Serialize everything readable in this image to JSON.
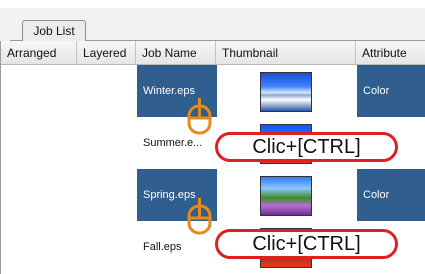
{
  "tab": {
    "label": "Job List"
  },
  "columns": [
    "Arranged",
    "Layered",
    "Job Name",
    "Thumbnail",
    "Attribute"
  ],
  "rows": [
    {
      "name": "Winter.eps",
      "attribute": "Color",
      "selected": true
    },
    {
      "name": "Summer.e...",
      "attribute": "",
      "selected": false
    },
    {
      "name": "Spring.eps",
      "attribute": "Color",
      "selected": true
    },
    {
      "name": "Fall.eps",
      "attribute": "",
      "selected": false
    }
  ],
  "callouts": [
    "Clic+[CTRL]",
    "Clic+[CTRL]"
  ],
  "colors": {
    "selection": "#2f5e8f",
    "callout_border": "#df2020",
    "mouse_icon": "#e78a1a"
  }
}
